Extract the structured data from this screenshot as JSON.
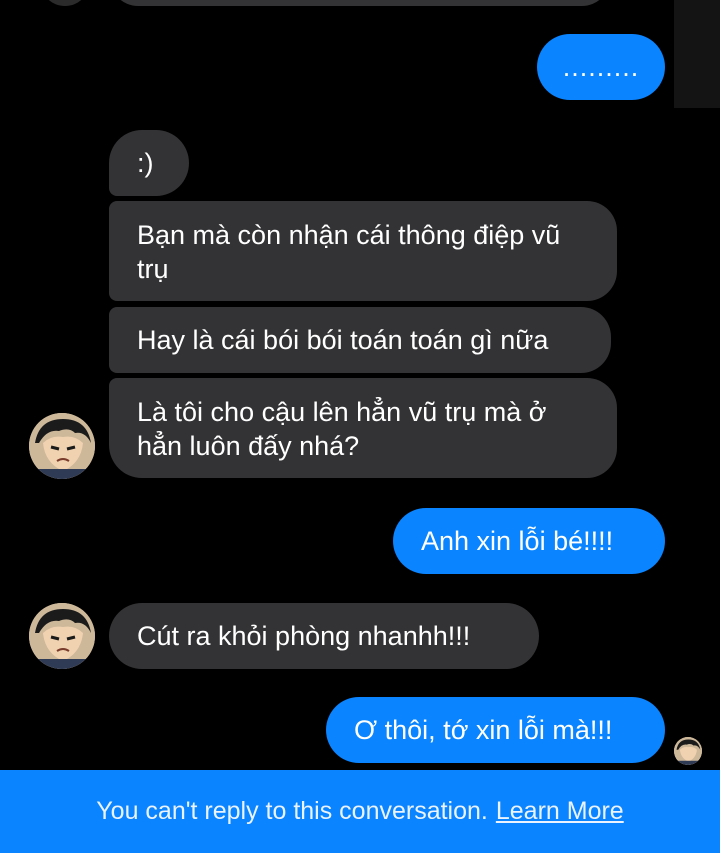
{
  "messages": [
    {
      "id": "m0",
      "direction": "outgoing",
      "text": "........."
    },
    {
      "id": "m1",
      "direction": "incoming",
      "text": ":)"
    },
    {
      "id": "m2",
      "direction": "incoming",
      "text": "Bạn mà còn nhận cái thông điệp vũ trụ"
    },
    {
      "id": "m3",
      "direction": "incoming",
      "text": "Hay là cái bói bói toán toán gì nữa"
    },
    {
      "id": "m4",
      "direction": "incoming",
      "text": "Là tôi cho cậu lên hẳn vũ trụ mà ở hẳn luôn đấy nhá?"
    },
    {
      "id": "m5",
      "direction": "outgoing",
      "text": "Anh xin lỗi bé!!!!"
    },
    {
      "id": "m6",
      "direction": "incoming",
      "text": "Cút ra khỏi phòng nhanhh!!!"
    },
    {
      "id": "m7",
      "direction": "outgoing",
      "text": "Ơ thôi, tớ xin lỗi mà!!!"
    }
  ],
  "footer": {
    "notice": "You can't reply to this conversation.",
    "link": "Learn More"
  },
  "colors": {
    "background": "#000000",
    "incoming_bubble": "#333335",
    "outgoing_bubble": "#0a84ff",
    "footer_bar": "#0a84ff"
  },
  "icons": {
    "contact_avatar": "anime-boy-avatar",
    "read_receipt": "small-avatar-seen-icon"
  }
}
